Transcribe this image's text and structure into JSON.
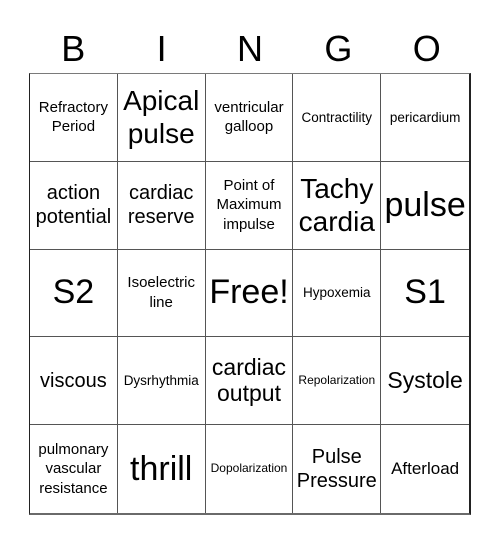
{
  "header": {
    "letters": [
      "B",
      "I",
      "N",
      "G",
      "O"
    ]
  },
  "cells": [
    {
      "text": "Refractory Period",
      "size": "s-xs"
    },
    {
      "text": "Apical pulse",
      "size": "s-l"
    },
    {
      "text": "ventricular galloop",
      "size": "s-xs"
    },
    {
      "text": "Contractility",
      "size": "s-xxs"
    },
    {
      "text": "pericardium",
      "size": "s-xxs"
    },
    {
      "text": "action potential",
      "size": "s-m"
    },
    {
      "text": "cardiac reserve",
      "size": "s-m"
    },
    {
      "text": "Point of Maximum impulse",
      "size": "s-xs"
    },
    {
      "text": "Tachy cardia",
      "size": "s-l"
    },
    {
      "text": "pulse",
      "size": "s-xl"
    },
    {
      "text": "S2",
      "size": "s-xl"
    },
    {
      "text": "Isoelectric line",
      "size": "s-xs"
    },
    {
      "text": "Free!",
      "size": "s-xl"
    },
    {
      "text": "Hypoxemia",
      "size": "s-xxs"
    },
    {
      "text": "S1",
      "size": "s-xl"
    },
    {
      "text": "viscous",
      "size": "s-m"
    },
    {
      "text": "Dysrhythmia",
      "size": "s-xxs"
    },
    {
      "text": "cardiac output",
      "size": "s-ml"
    },
    {
      "text": "Repolarization",
      "size": "s-t"
    },
    {
      "text": "Systole",
      "size": "s-ml"
    },
    {
      "text": "pulmonary vascular resistance",
      "size": "s-xs"
    },
    {
      "text": "thrill",
      "size": "s-xl"
    },
    {
      "text": "Dopolarization",
      "size": "s-t"
    },
    {
      "text": "Pulse Pressure",
      "size": "s-m"
    },
    {
      "text": "Afterload",
      "size": "s-s"
    }
  ]
}
